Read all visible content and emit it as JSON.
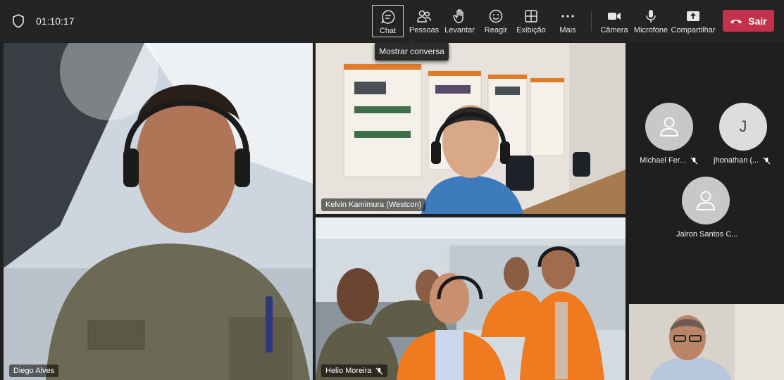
{
  "meeting": {
    "timer": "01:10:17"
  },
  "toolbar": {
    "chat": "Chat",
    "people": "Pessoas",
    "raise": "Levantar",
    "react": "Reagir",
    "view": "Exibição",
    "more": "Mais",
    "camera": "Câmera",
    "mic": "Microfone",
    "share": "Compartilhar",
    "leave": "Sair"
  },
  "tooltip": {
    "text": "Mostrar conversa"
  },
  "participants": {
    "diego": "Diego Alves",
    "kelvin": "Kelvin Kamimura (Westcon)",
    "helio": "Helio Moreira",
    "michael": "Michael Fer...",
    "jhonathan": "jhonathan (...",
    "jhonathan_initial": "J",
    "jairon": "Jairon Santos C..."
  },
  "colors": {
    "leave": "#c4314b",
    "background": "#1f1f1f",
    "toolbar": "#242424"
  }
}
